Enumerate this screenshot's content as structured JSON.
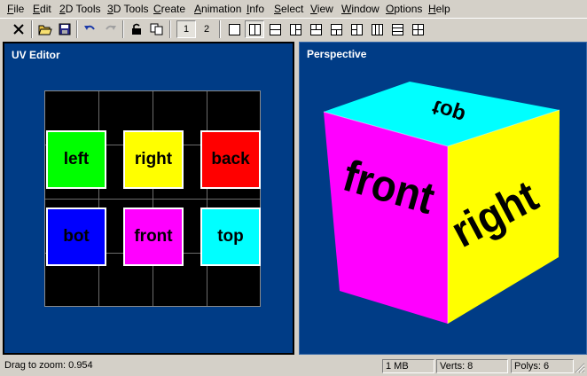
{
  "menu": [
    "File",
    "Edit",
    "2D Tools",
    "3D Tools",
    "Create",
    "Animation",
    "Info",
    "Select",
    "View",
    "Window",
    "Options",
    "Help"
  ],
  "toolbar": {
    "tools": [
      "close-icon",
      "open-folder-icon",
      "save-icon",
      "undo-icon",
      "redo-icon",
      "lock-icon",
      "copy-icon"
    ],
    "pages": [
      "1",
      "2"
    ],
    "layouts": [
      "layout-single-icon",
      "layout-two-vertical-icon",
      "layout-two-horizontal-icon",
      "layout-three-left-icon",
      "layout-three-top-icon",
      "layout-three-bottom-icon",
      "layout-three-vertical-icon",
      "layout-three-horizontal-icon",
      "layout-four-icon"
    ]
  },
  "uv_editor": {
    "title": "UV Editor",
    "tiles": [
      {
        "label": "left",
        "color": "#00ff00"
      },
      {
        "label": "right",
        "color": "#ffff00"
      },
      {
        "label": "back",
        "color": "#ff0000"
      },
      {
        "label": "bot",
        "color": "#0000ff"
      },
      {
        "label": "front",
        "color": "#ff00ff"
      },
      {
        "label": "top",
        "color": "#00ffff"
      }
    ]
  },
  "perspective": {
    "title": "Perspective",
    "faces": {
      "top": {
        "label": "top",
        "color": "#00ffff"
      },
      "front": {
        "label": "front",
        "color": "#ff00ff"
      },
      "right": {
        "label": "right",
        "color": "#ffff00"
      }
    }
  },
  "status": {
    "message": "Drag to zoom: 0.954",
    "memory": "1 MB",
    "verts": "Verts: 8",
    "polys": "Polys: 6"
  },
  "colors": {
    "viewport_bg": "#003c86",
    "chrome": "#d4d0c8"
  }
}
